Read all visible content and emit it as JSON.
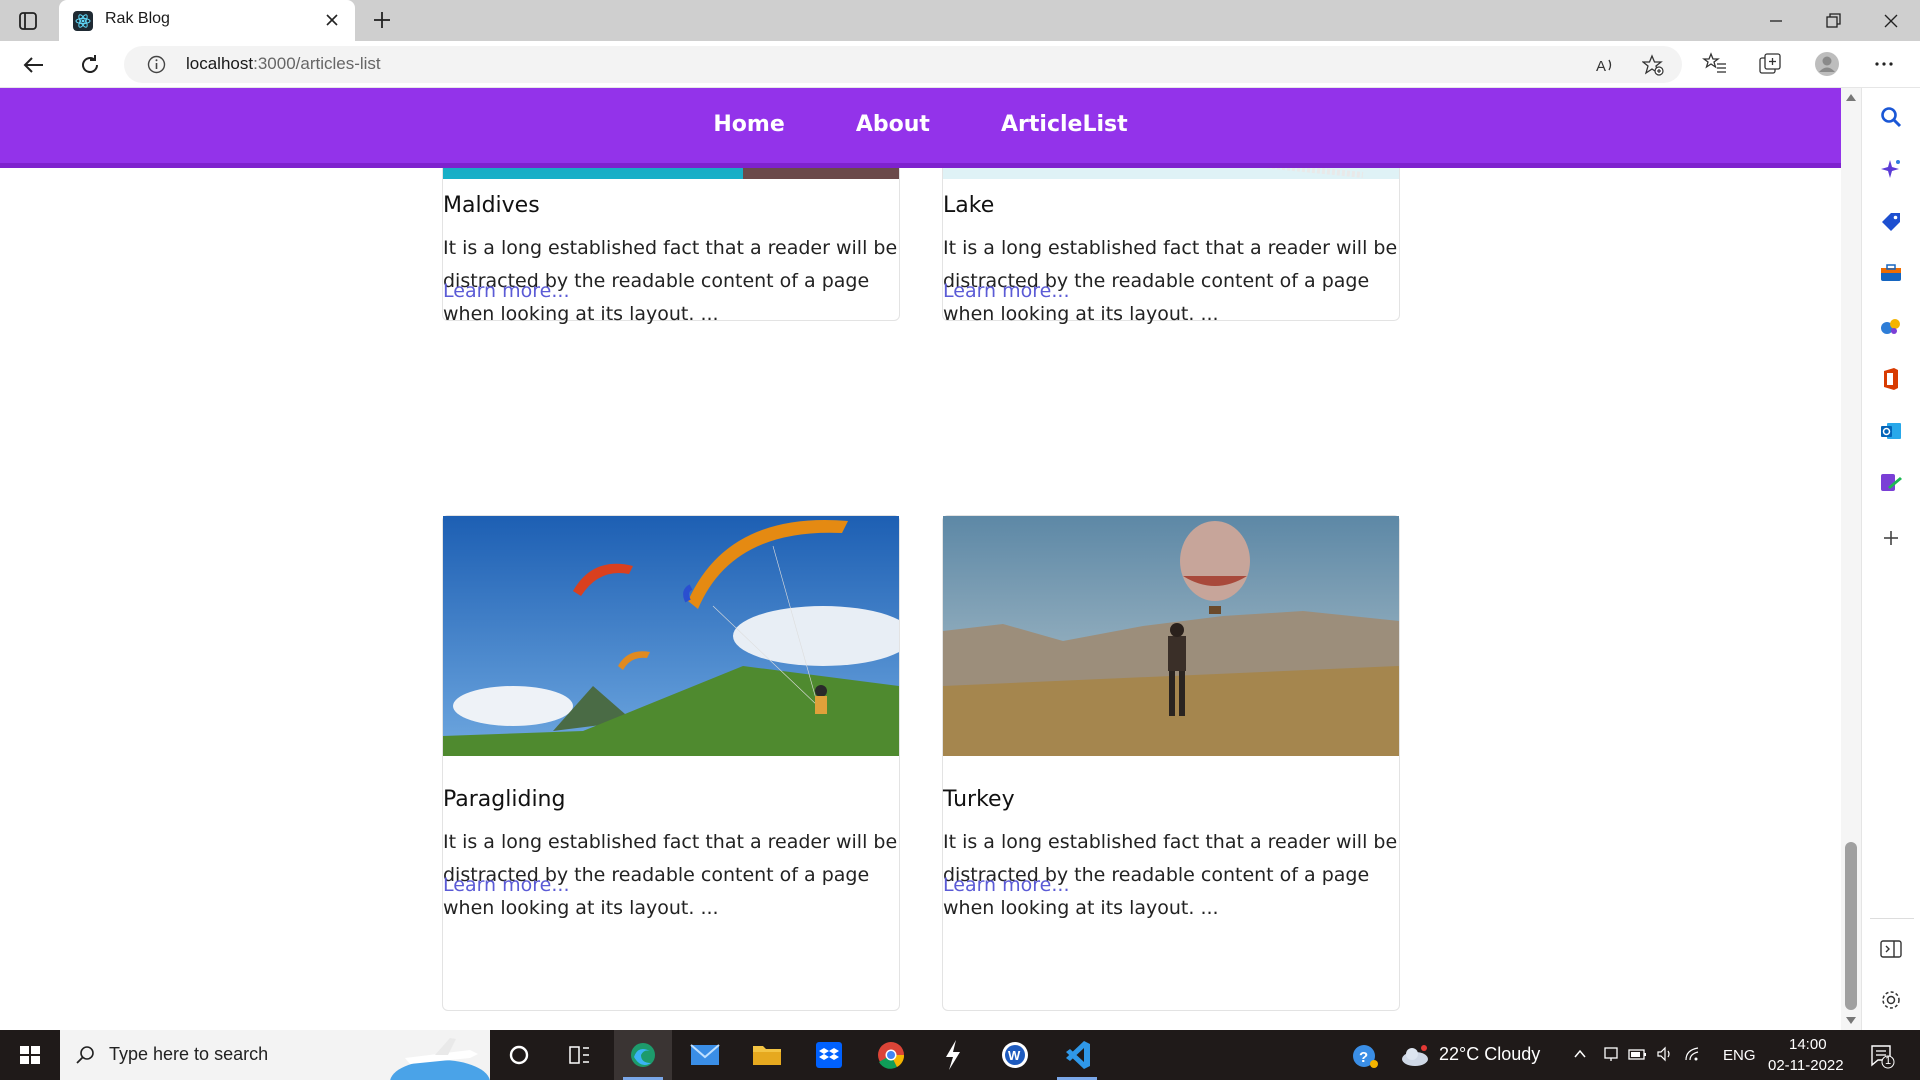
{
  "browser": {
    "tab_title": "Rak Blog",
    "url_host": "localhost",
    "url_path": ":3000/articles-list"
  },
  "site_nav": {
    "links": [
      "Home",
      "About",
      "ArticleList"
    ]
  },
  "articles": [
    {
      "title": "Maldives",
      "excerpt": "It is a long established fact that a reader will be distracted by the readable content of a page when looking at its layout. ...",
      "link": "Learn more..."
    },
    {
      "title": "Lake",
      "excerpt": "It is a long established fact that a reader will be distracted by the readable content of a page when looking at its layout. ...",
      "link": "Learn more..."
    },
    {
      "title": "Paragliding",
      "excerpt": "It is a long established fact that a reader will be distracted by the readable content of a page when looking at its layout. ...",
      "link": "Learn more..."
    },
    {
      "title": "Turkey",
      "excerpt": "It is a long established fact that a reader will be distracted by the readable content of a page when looking at its layout. ...",
      "link": "Learn more..."
    }
  ],
  "taskbar": {
    "search_placeholder": "Type here to search",
    "weather": "22°C  Cloudy",
    "language": "ENG",
    "time": "14:00",
    "date": "02-11-2022",
    "notification_count": "1"
  },
  "colors": {
    "nav_bg": "#9333ea",
    "link": "#5b5bd6"
  }
}
